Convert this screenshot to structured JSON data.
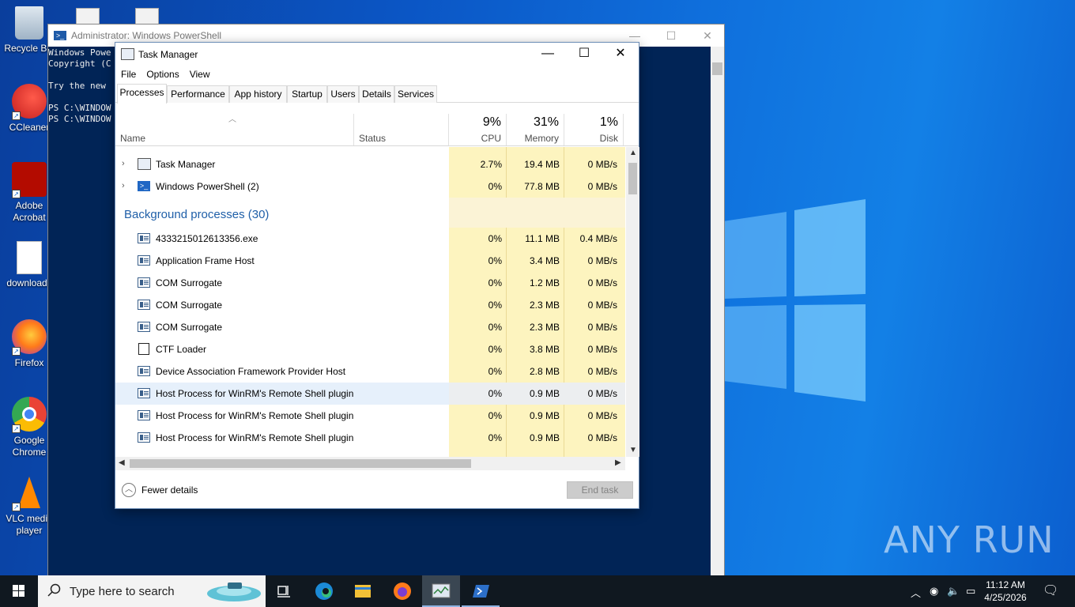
{
  "desktop": {
    "icons": [
      {
        "label": "Recycle Bin"
      },
      {
        "label": "CCleaner"
      },
      {
        "label": "Adobe Acrobat"
      },
      {
        "label": "downloads"
      },
      {
        "label": "Firefox"
      },
      {
        "label": "Google Chrome"
      },
      {
        "label": "VLC media player"
      }
    ],
    "watermark": "ANY RUN"
  },
  "powershell": {
    "title": "Administrator: Windows PowerShell",
    "lines": [
      "Windows Powe",
      "Copyright (C",
      "",
      "Try the new",
      "",
      "PS C:\\WINDOW",
      "PS C:\\WINDOW"
    ]
  },
  "taskmanager": {
    "title": "Task Manager",
    "menu": [
      "File",
      "Options",
      "View"
    ],
    "tabs": [
      "Processes",
      "Performance",
      "App history",
      "Startup",
      "Users",
      "Details",
      "Services"
    ],
    "active_tab": "Processes",
    "columns": {
      "name": "Name",
      "status": "Status",
      "cpu": {
        "percent": "9%",
        "label": "CPU"
      },
      "memory": {
        "percent": "31%",
        "label": "Memory"
      },
      "disk": {
        "percent": "1%",
        "label": "Disk"
      }
    },
    "apps": [
      {
        "name": "Task Manager",
        "cpu": "2.7%",
        "memory": "19.4 MB",
        "disk": "0 MB/s",
        "icon": "taskmanager-icon"
      },
      {
        "name": "Windows PowerShell (2)",
        "cpu": "0%",
        "memory": "77.8 MB",
        "disk": "0 MB/s",
        "icon": "powershell-icon"
      }
    ],
    "background_group": "Background processes (30)",
    "background": [
      {
        "name": "4333215012613356.exe",
        "cpu": "0%",
        "memory": "11.1 MB",
        "disk": "0.4 MB/s"
      },
      {
        "name": "Application Frame Host",
        "cpu": "0%",
        "memory": "3.4 MB",
        "disk": "0 MB/s"
      },
      {
        "name": "COM Surrogate",
        "cpu": "0%",
        "memory": "1.2 MB",
        "disk": "0 MB/s"
      },
      {
        "name": "COM Surrogate",
        "cpu": "0%",
        "memory": "2.3 MB",
        "disk": "0 MB/s"
      },
      {
        "name": "COM Surrogate",
        "cpu": "0%",
        "memory": "2.3 MB",
        "disk": "0 MB/s"
      },
      {
        "name": "CTF Loader",
        "cpu": "0%",
        "memory": "3.8 MB",
        "disk": "0 MB/s"
      },
      {
        "name": "Device Association Framework Provider Host",
        "cpu": "0%",
        "memory": "2.8 MB",
        "disk": "0 MB/s"
      },
      {
        "name": "Host Process for WinRM's Remote Shell plugin",
        "cpu": "0%",
        "memory": "0.9 MB",
        "disk": "0 MB/s"
      },
      {
        "name": "Host Process for WinRM's Remote Shell plugin",
        "cpu": "0%",
        "memory": "0.9 MB",
        "disk": "0 MB/s"
      },
      {
        "name": "Host Process for WinRM's Remote Shell plugin",
        "cpu": "0%",
        "memory": "0.9 MB",
        "disk": "0 MB/s"
      }
    ],
    "fewer_details": "Fewer details",
    "end_task": "End task"
  },
  "taskbar": {
    "search_placeholder": "Type here to search",
    "clock_time": "11:12 AM",
    "clock_date": "4/25/2026"
  }
}
